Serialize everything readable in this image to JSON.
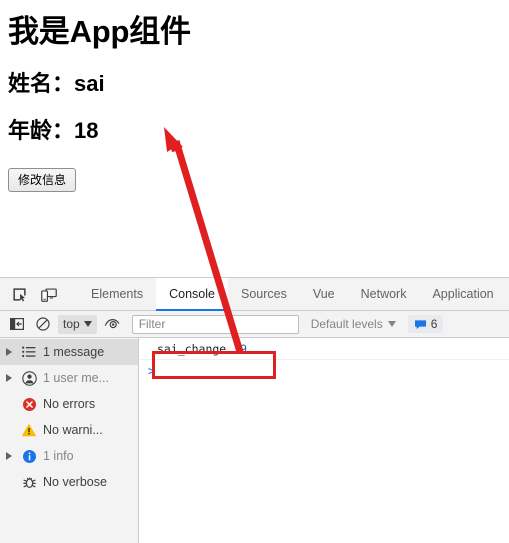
{
  "page": {
    "heading": "我是App组件",
    "name_line": "姓名：sai",
    "age_line": "年龄：18",
    "button_label": "修改信息"
  },
  "devtools": {
    "toolbar_icons": [
      {
        "name": "inspect-element-icon",
        "title": "Inspect element"
      },
      {
        "name": "device-toolbar-icon",
        "title": "Toggle device toolbar"
      }
    ],
    "tabs": [
      {
        "label": "Elements",
        "active": false
      },
      {
        "label": "Console",
        "active": true
      },
      {
        "label": "Sources",
        "active": false
      },
      {
        "label": "Vue",
        "active": false
      },
      {
        "label": "Network",
        "active": false
      },
      {
        "label": "Application",
        "active": false
      }
    ],
    "console_toolbar": {
      "sidebar_toggle_icon": "console-sidebar-icon",
      "clear_icon": "clear-console-icon",
      "context_label": "top",
      "eye_icon": "live-expression-eye-icon",
      "filter_placeholder": "Filter",
      "filter_value": "",
      "levels_label": "Default levels",
      "issues_icon": "message-bubble-icon",
      "issues_count": "6"
    },
    "sidebar": [
      {
        "label": "1 message",
        "icon": "list-icon",
        "expandable": true,
        "selected": true,
        "dim": false
      },
      {
        "label": "1 user me...",
        "icon": "user-icon",
        "expandable": true,
        "selected": false,
        "dim": true
      },
      {
        "label": "No errors",
        "icon": "error-icon",
        "expandable": false,
        "selected": false,
        "dim": false
      },
      {
        "label": "No warni...",
        "icon": "warning-icon",
        "expandable": false,
        "selected": false,
        "dim": false
      },
      {
        "label": "1 info",
        "icon": "info-icon",
        "expandable": true,
        "selected": false,
        "dim": true
      },
      {
        "label": "No verbose",
        "icon": "verbose-bug-icon",
        "expandable": false,
        "selected": false,
        "dim": false
      }
    ],
    "console_output": {
      "message_text": "sai_change",
      "message_value": "19",
      "prompt_symbol": ">"
    }
  },
  "annotations": {
    "highlight_color": "#e02020",
    "arrow_color": "#e02020"
  }
}
